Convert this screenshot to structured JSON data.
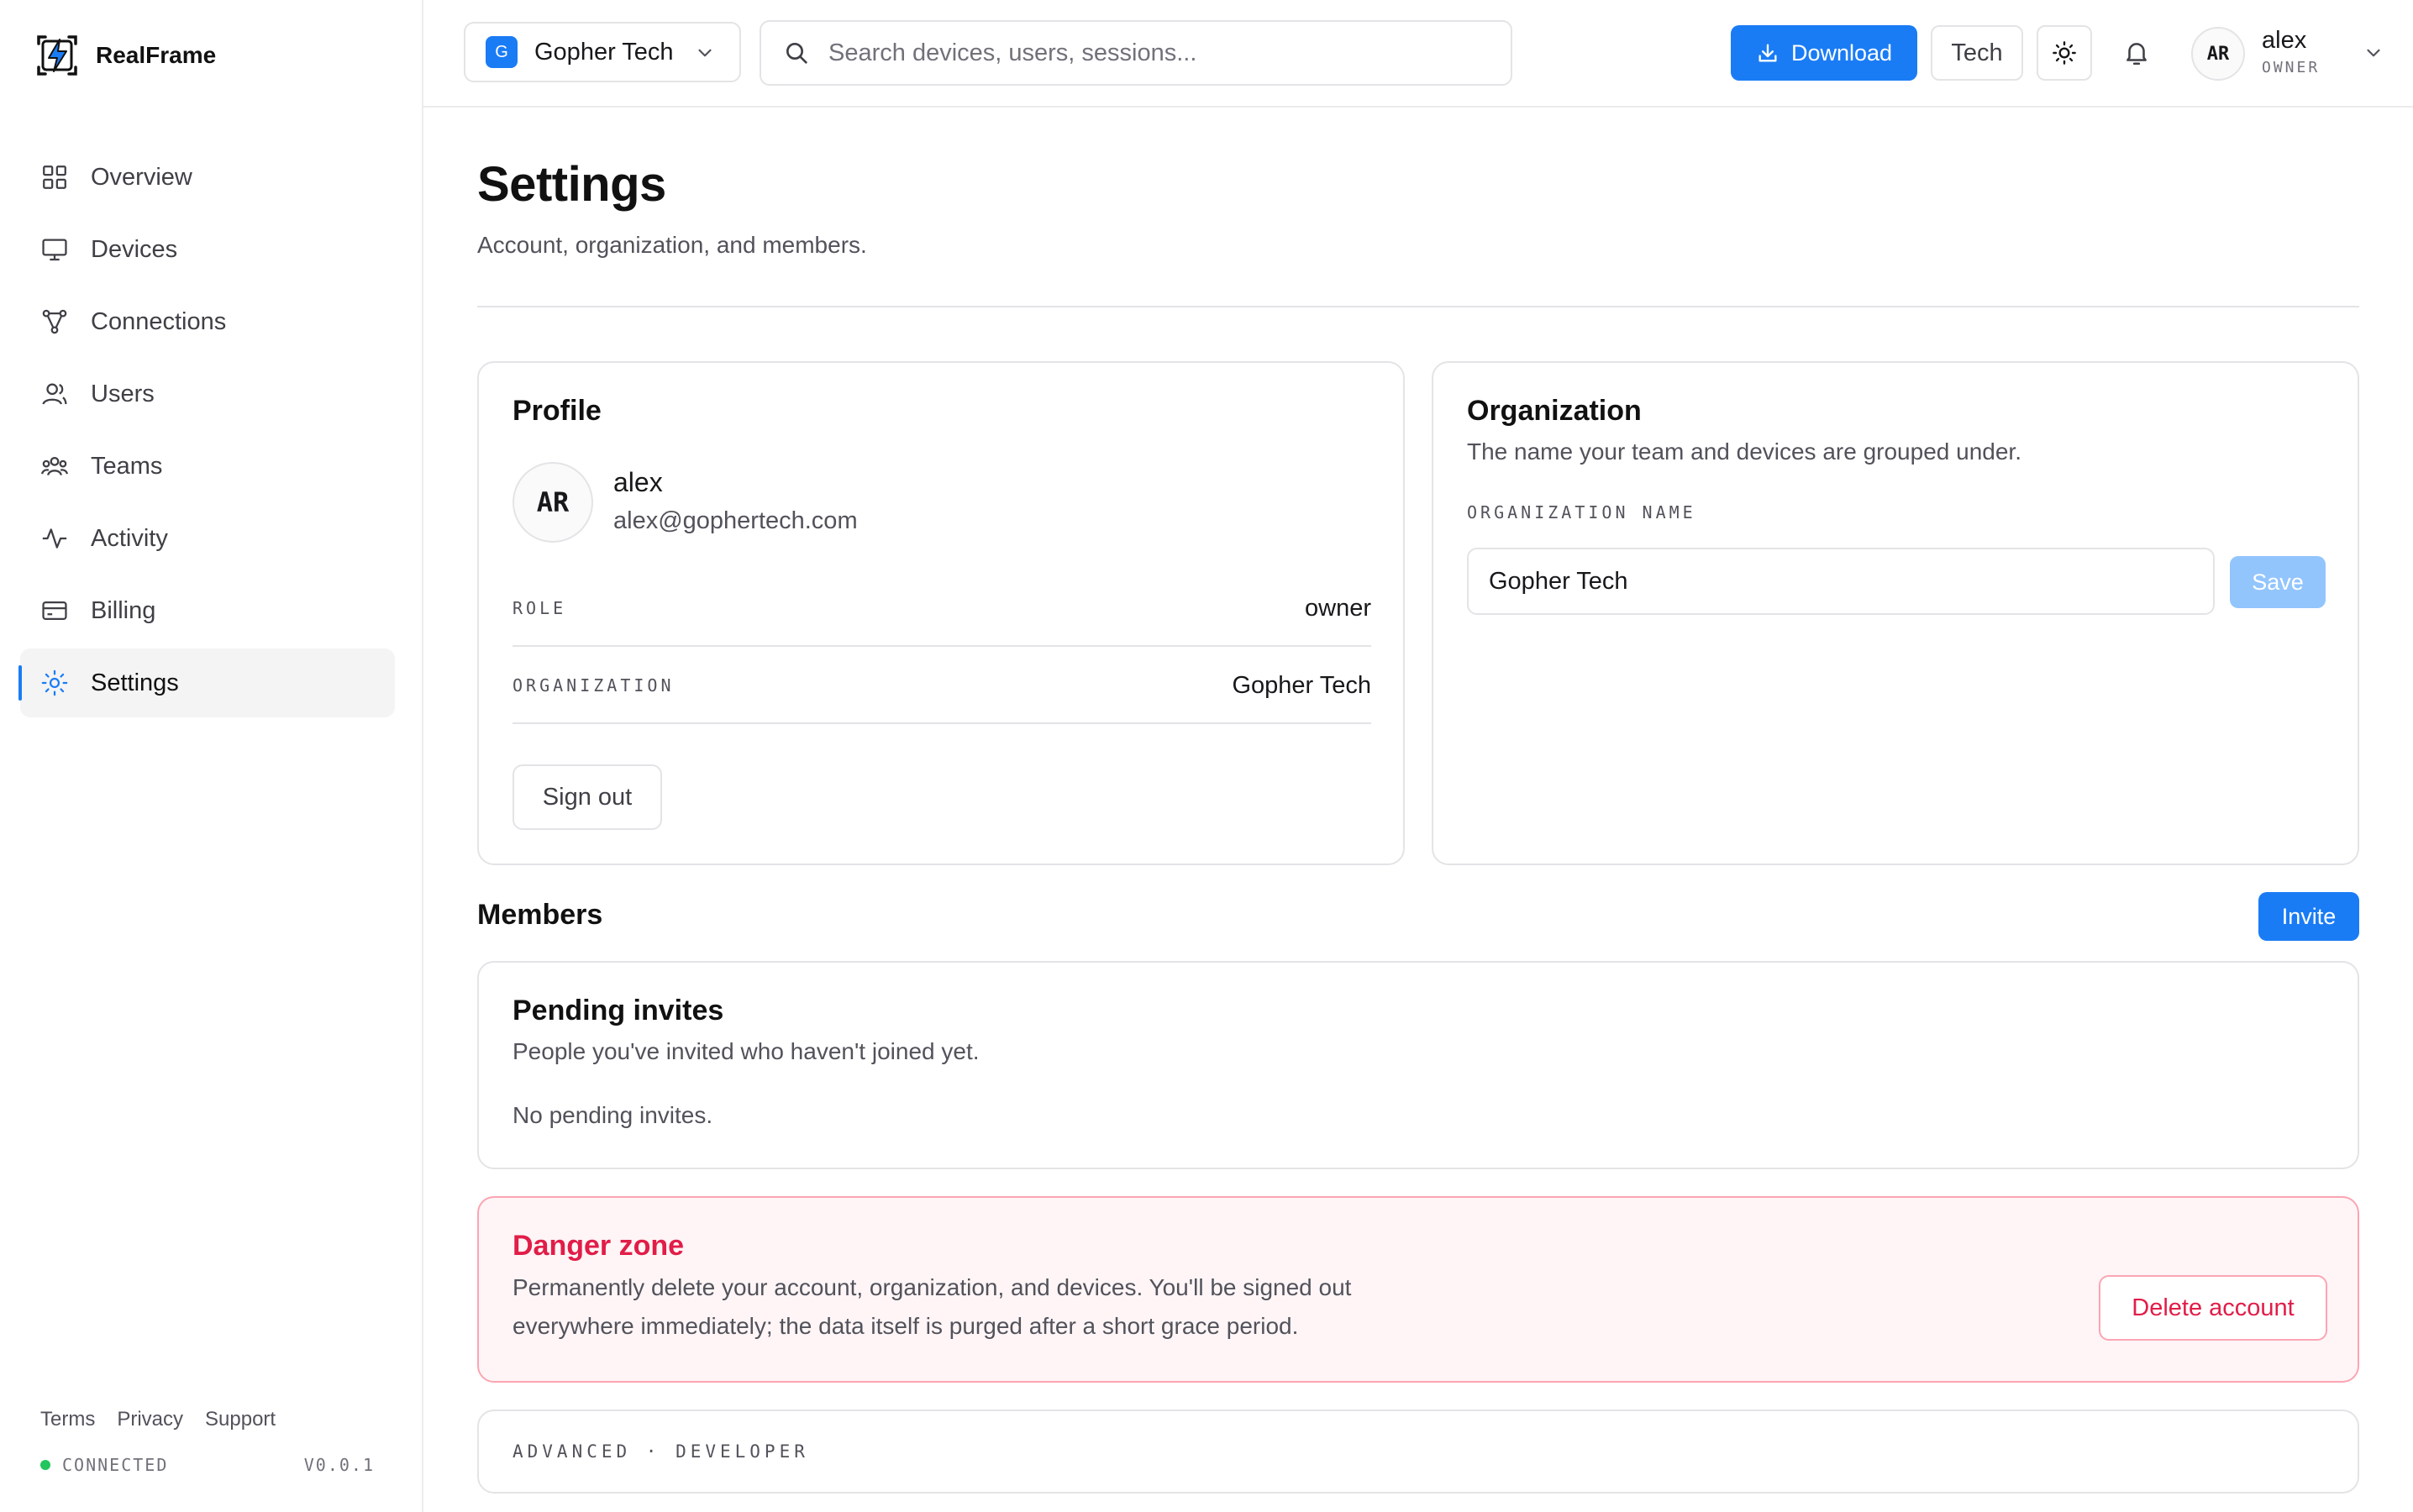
{
  "app": {
    "name": "RealFrame",
    "accent_color": "#1a7cf5",
    "danger_color": "#e11d48"
  },
  "sidebar": {
    "items": [
      {
        "label": "Overview",
        "icon": "grid-icon"
      },
      {
        "label": "Devices",
        "icon": "monitor-icon"
      },
      {
        "label": "Connections",
        "icon": "network-icon"
      },
      {
        "label": "Users",
        "icon": "user-icon"
      },
      {
        "label": "Teams",
        "icon": "users-icon"
      },
      {
        "label": "Activity",
        "icon": "activity-icon"
      },
      {
        "label": "Billing",
        "icon": "credit-card-icon"
      },
      {
        "label": "Settings",
        "icon": "settings-icon",
        "active": true
      }
    ],
    "footer_links": [
      "Terms",
      "Privacy",
      "Support"
    ],
    "status": "CONNECTED",
    "status_color": "#22c55e",
    "version": "V0.0.1"
  },
  "topbar": {
    "org_initial": "G",
    "org_name": "Gopher Tech",
    "search_placeholder": "Search devices, users, sessions...",
    "download_label": "Download",
    "tech_label": "Tech",
    "user_initials": "AR",
    "user_name": "alex",
    "user_role": "OWNER"
  },
  "page": {
    "title": "Settings",
    "subtitle": "Account, organization, and members."
  },
  "profile": {
    "title": "Profile",
    "initials": "AR",
    "name": "alex",
    "email": "alex@gophertech.com",
    "role_label": "ROLE",
    "role_value": "owner",
    "org_label": "ORGANIZATION",
    "org_value": "Gopher Tech",
    "sign_out_label": "Sign out"
  },
  "organization": {
    "title": "Organization",
    "description": "The name your team and devices are grouped under.",
    "field_label": "ORGANIZATION NAME",
    "field_value": "Gopher Tech",
    "save_label": "Save"
  },
  "members": {
    "title": "Members",
    "invite_label": "Invite",
    "pending_title": "Pending invites",
    "pending_description": "People you've invited who haven't joined yet.",
    "pending_empty": "No pending invites."
  },
  "danger": {
    "title": "Danger zone",
    "description": "Permanently delete your account, organization, and devices. You'll be signed out everywhere immediately; the data itself is purged after a short grace period.",
    "delete_label": "Delete account"
  },
  "advanced": {
    "label": "ADVANCED · DEVELOPER"
  }
}
